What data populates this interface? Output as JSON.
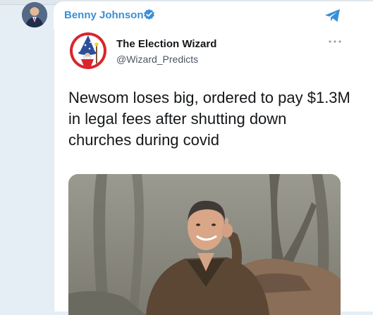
{
  "channel": {
    "name": "Benny Johnson",
    "verified": true,
    "accent": "#3a8fd4"
  },
  "tweet": {
    "author_name": "The Election Wizard",
    "author_handle": "@Wizard_Predicts",
    "text": "Newsom loses big, ordered to pay $1.3M in legal fees after shutting down churches during covid"
  },
  "icons": {
    "share": "telegram-share-icon",
    "more": "more-options-icon",
    "verified": "verified-badge-icon"
  }
}
